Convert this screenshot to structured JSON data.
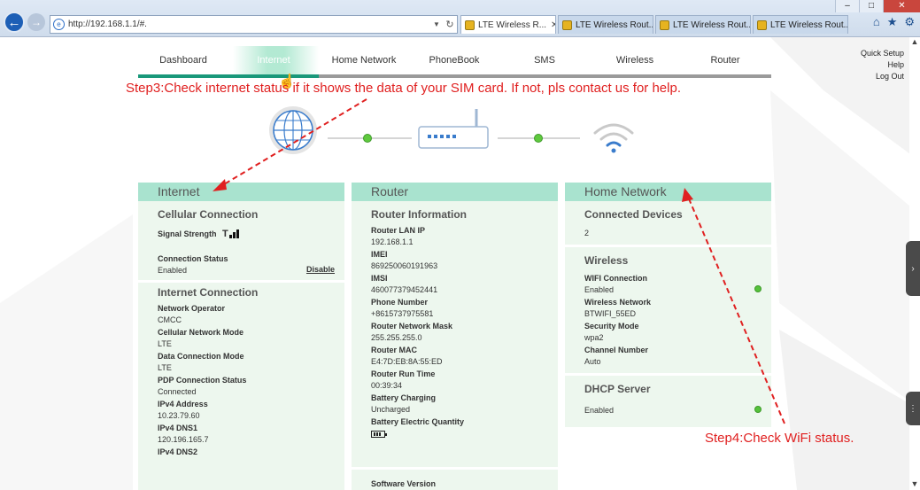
{
  "browser": {
    "window_controls": {
      "minimize": "–",
      "maximize": "□",
      "close": "✕"
    },
    "url": "http://192.168.1.1/#.",
    "tabs": [
      {
        "label": "LTE Wireless R...",
        "active": true
      },
      {
        "label": "LTE Wireless Rout...",
        "active": false
      },
      {
        "label": "LTE Wireless Rout...",
        "active": false
      },
      {
        "label": "LTE Wireless Rout...",
        "active": false
      }
    ],
    "toolbar_icons": [
      "home-icon",
      "star-icon",
      "gear-icon"
    ]
  },
  "nav": {
    "items": [
      "Dashboard",
      "Internet",
      "Home Network",
      "PhoneBook",
      "SMS",
      "Wireless",
      "Router"
    ],
    "selected": "Internet"
  },
  "top_links": [
    "Quick Setup",
    "Help",
    "Log Out"
  ],
  "annotations": {
    "step3": "Step3:Check internet status if it shows the data of your SIM card. If not, pls contact us for help.",
    "step4": "Step4:Check WiFi status.",
    "color": "#e02020"
  },
  "panels": {
    "internet": {
      "title": "Internet",
      "cellular": {
        "heading": "Cellular Connection",
        "signal_label": "Signal Strength",
        "signal_bars": 3,
        "status_label": "Connection Status",
        "status_value": "Enabled",
        "disable_label": "Disable"
      },
      "connection": {
        "heading": "Internet Connection",
        "fields": [
          {
            "label": "Network Operator",
            "value": "CMCC"
          },
          {
            "label": "Cellular Network Mode",
            "value": "LTE"
          },
          {
            "label": "Data Connection Mode",
            "value": "LTE"
          },
          {
            "label": "PDP Connection Status",
            "value": "Connected"
          },
          {
            "label": "IPv4 Address",
            "value": "10.23.79.60"
          },
          {
            "label": "IPv4 DNS1",
            "value": "120.196.165.7"
          },
          {
            "label": "IPv4 DNS2",
            "value": ""
          }
        ]
      }
    },
    "router": {
      "title": "Router",
      "heading": "Router Information",
      "fields": [
        {
          "label": "Router LAN IP",
          "value": "192.168.1.1"
        },
        {
          "label": "IMEI",
          "value": "869250060191963"
        },
        {
          "label": "IMSI",
          "value": "460077379452441"
        },
        {
          "label": "Phone Number",
          "value": "+8615737975581"
        },
        {
          "label": "Router Network Mask",
          "value": "255.255.255.0"
        },
        {
          "label": "Router MAC",
          "value": "E4:7D:EB:8A:55:ED"
        },
        {
          "label": "Router Run Time",
          "value": "00:39:34"
        },
        {
          "label": "Battery Charging",
          "value": "Uncharged"
        },
        {
          "label": "Battery Electric Quantity",
          "value": ""
        }
      ],
      "software_version_label": "Software Version"
    },
    "home_network": {
      "title": "Home Network",
      "devices": {
        "heading": "Connected Devices",
        "value": "2"
      },
      "wireless": {
        "heading": "Wireless",
        "fields": [
          {
            "label": "WIFI Connection",
            "value": "Enabled",
            "dot": true
          },
          {
            "label": "Wireless Network",
            "value": "BTWIFI_55ED",
            "dot": false
          },
          {
            "label": "Security Mode",
            "value": "wpa2",
            "dot": false
          },
          {
            "label": "Channel Number",
            "value": "Auto",
            "dot": false
          }
        ]
      },
      "dhcp": {
        "heading": "DHCP Server",
        "value": "Enabled"
      }
    }
  },
  "colors": {
    "accent": "#19987a",
    "panel_header": "#a9e3cf",
    "panel_body": "#edf7ee",
    "status_dot": "#55c23b"
  }
}
